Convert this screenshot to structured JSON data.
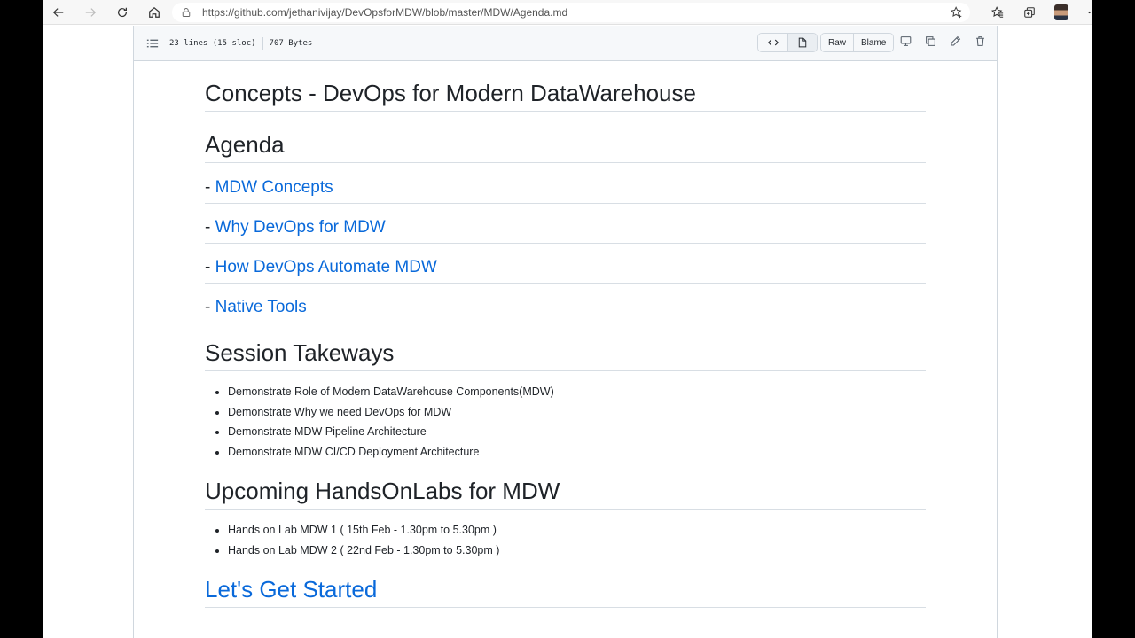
{
  "browser": {
    "url": "https://github.com/jethanivijay/DevOpsforMDW/blob/master/MDW/Agenda.md"
  },
  "file": {
    "lines_info": "23 lines (15 sloc)",
    "size": "707 Bytes",
    "raw_label": "Raw",
    "blame_label": "Blame"
  },
  "content": {
    "title": "Concepts - DevOps for Modern DataWarehouse",
    "agenda_heading": "Agenda",
    "agenda_prefix": "- ",
    "agenda_items": [
      "MDW Concepts",
      "Why DevOps for MDW",
      "How DevOps Automate MDW",
      "Native Tools"
    ],
    "takeaways_heading": "Session Takeways",
    "takeaways": [
      "Demonstrate Role of Modern DataWarehouse Components(MDW)",
      "Demonstrate Why we need DevOps for MDW",
      "Demonstrate MDW Pipeline Architecture",
      "Demonstrate MDW CI/CD Deployment Architecture"
    ],
    "labs_heading": "Upcoming HandsOnLabs for MDW",
    "labs": [
      "Hands on Lab MDW 1 ( 15th Feb - 1.30pm to 5.30pm )",
      "Hands on Lab MDW 2 ( 22nd Feb - 1.30pm to 5.30pm )"
    ],
    "get_started": "Let's Get Started"
  }
}
